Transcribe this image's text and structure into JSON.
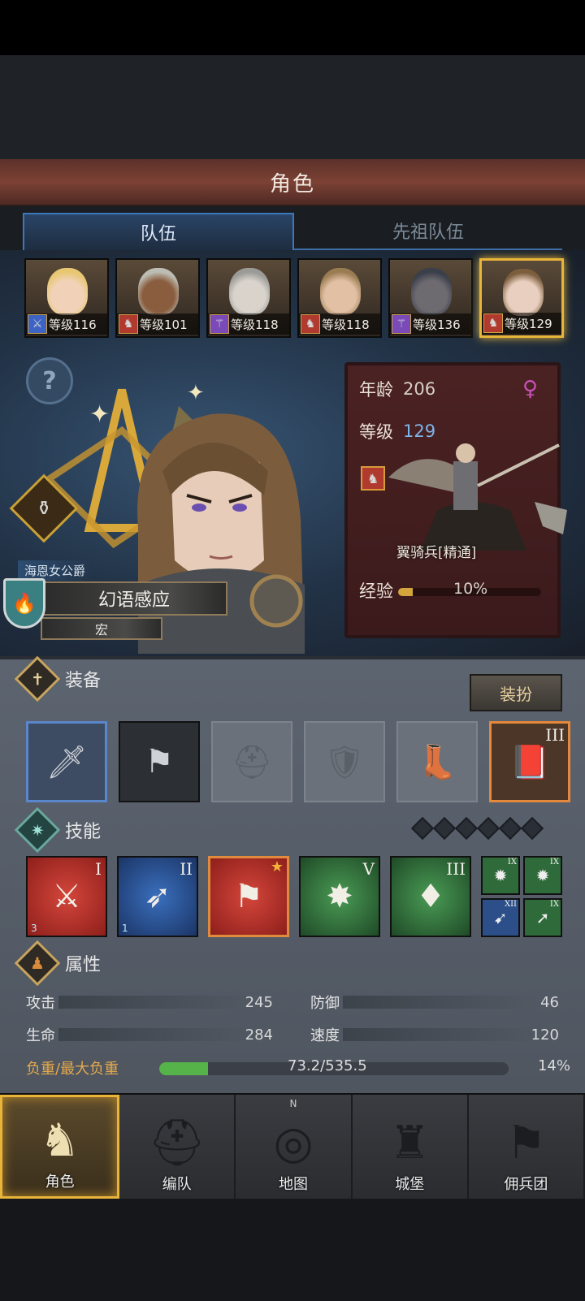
{
  "header": {
    "title": "角色"
  },
  "tabs": [
    {
      "label": "队伍",
      "active": true
    },
    {
      "label": "先祖队伍",
      "active": false
    }
  ],
  "team": [
    {
      "level": "等级116",
      "class_icon": "sword-icon",
      "class_color": "#3d64c4",
      "hair": "#e7c772",
      "skin": "#f1d2b8"
    },
    {
      "level": "等级101",
      "class_icon": "horse-icon",
      "class_color": "#b13a2e",
      "hair": "#bdbdb5",
      "skin": "#8a5d3e"
    },
    {
      "level": "等级118",
      "class_icon": "staff-icon",
      "class_color": "#7a4bb8",
      "hair": "#9a9a96",
      "skin": "#d9d3cc"
    },
    {
      "level": "等级118",
      "class_icon": "horse-icon",
      "class_color": "#b13a2e",
      "hair": "#9a7c52",
      "skin": "#e2c0a4"
    },
    {
      "level": "等级136",
      "class_icon": "staff-icon",
      "class_color": "#7a4bb8",
      "hair": "#3a3f4a",
      "skin": "#6d6a70"
    },
    {
      "level": "等级129",
      "class_icon": "horse-icon",
      "class_color": "#b13a2e",
      "hair": "#7c5e3e",
      "skin": "#e8cfbf",
      "selected": true
    }
  ],
  "hero": {
    "title": "海恩女公爵",
    "ability": "幻语感应",
    "ability_sub": "宏"
  },
  "info": {
    "age_label": "年龄",
    "age": "206",
    "level_label": "等级",
    "level": "129",
    "gender_icon": "female-icon",
    "unit_name": "翼骑兵[精通]",
    "exp_label": "经验",
    "exp": "10%",
    "exp_fraction": 0.1
  },
  "equipment": {
    "label": "装备",
    "dress_button": "装扮",
    "slots": [
      {
        "name": "sword",
        "filled": true
      },
      {
        "name": "banner",
        "filled": true
      },
      {
        "name": "helmet",
        "filled": false
      },
      {
        "name": "armor",
        "filled": false
      },
      {
        "name": "boots",
        "filled": false
      },
      {
        "name": "book",
        "filled": true,
        "tier": "III"
      }
    ]
  },
  "skills": {
    "label": "技能",
    "slot_count": 6,
    "items": [
      {
        "tier": "I",
        "rank": "3",
        "color": "red"
      },
      {
        "tier": "II",
        "rank": "1",
        "color": "blue"
      },
      {
        "tier": "",
        "rank": "",
        "color": "red",
        "starred": true
      },
      {
        "tier": "V",
        "rank": "",
        "color": "green"
      },
      {
        "tier": "III",
        "rank": "",
        "color": "green"
      }
    ],
    "mini": [
      {
        "tier": "IX",
        "color": "green"
      },
      {
        "tier": "IX",
        "color": "green"
      },
      {
        "tier": "XII",
        "color": "blue"
      },
      {
        "tier": "IX",
        "color": "green"
      }
    ]
  },
  "attributes": {
    "label": "属性",
    "attack_label": "攻击",
    "attack": "245",
    "defense_label": "防御",
    "defense": "46",
    "hp_label": "生命",
    "hp": "284",
    "speed_label": "速度",
    "speed": "120",
    "load_label": "负重/最大负重",
    "load": "73.2/535.5",
    "load_pct": "14%",
    "load_fraction": 0.14
  },
  "nav": [
    {
      "label": "角色",
      "icon": "knight-icon",
      "active": true
    },
    {
      "label": "编队",
      "icon": "helmet-icon",
      "active": false
    },
    {
      "label": "地图",
      "icon": "compass-icon",
      "active": false,
      "north": "N"
    },
    {
      "label": "城堡",
      "icon": "castle-icon",
      "active": false
    },
    {
      "label": "佣兵团",
      "icon": "banner-icon",
      "active": false
    }
  ]
}
